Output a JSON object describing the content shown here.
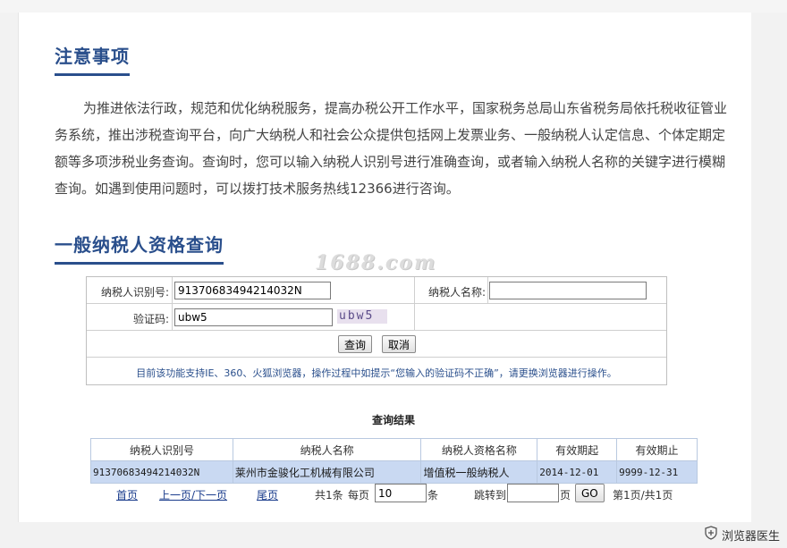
{
  "notice_section": {
    "title": "注意事项",
    "body": "为推进依法行政，规范和优化纳税服务，提高办税公开工作水平，国家税务总局山东省税务局依托税收征管业务系统，推出涉税查询平台，向广大纳税人和社会公众提供包括网上发票业务、一般纳税人认定信息、个体定期定额等多项涉税业务查询。查询时，您可以输入纳税人识别号进行准确查询，或者输入纳税人名称的关键字进行模糊查询。如遇到使用问题时，可以拨打技术服务热线12366进行咨询。"
  },
  "query_section": {
    "title": "一般纳税人资格查询"
  },
  "watermark": "1688.com",
  "form": {
    "taxid_label": "纳税人识别号:",
    "taxid_value": "91370683494214032N",
    "name_label": "纳税人名称:",
    "name_value": "",
    "captcha_label": "验证码:",
    "captcha_value": "ubw5",
    "captcha_image_text": "ubw5",
    "query_button": "查询",
    "cancel_button": "取消",
    "notice": "目前该功能支持IE、360、火狐浏览器，操作过程中如提示“您输入的验证码不正确”，请更换浏览器进行操作。"
  },
  "results": {
    "title": "查询结果",
    "columns": [
      "纳税人识别号",
      "纳税人名称",
      "纳税人资格名称",
      "有效期起",
      "有效期止"
    ],
    "rows": [
      [
        "91370683494214032N",
        "莱州市金骏化工机械有限公司",
        "增值税一般纳税人",
        "2014-12-01",
        "9999-12-31"
      ]
    ]
  },
  "pager": {
    "first": "首页",
    "prev_next": "上一页/下一页",
    "last": "尾页",
    "total": "共1条",
    "per_page_label": "每页",
    "per_page_value": "10",
    "per_page_unit": "条",
    "jump_label": "跳转到",
    "jump_value": "",
    "page_unit": "页",
    "go_button": "GO",
    "page_info": "第1页/共1页"
  },
  "browser_badge": {
    "icon": "shield-icon",
    "label": "浏览器医生"
  }
}
